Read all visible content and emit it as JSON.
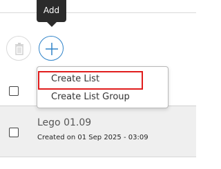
{
  "tooltip": {
    "text": "Add"
  },
  "toolbar": {
    "delete_icon": "trash-icon",
    "add_icon": "plus-icon",
    "accent_color": "#2f83c9"
  },
  "add_menu": {
    "items": [
      {
        "label": "Create List",
        "highlighted": true
      },
      {
        "label": "Create List Group",
        "highlighted": false
      }
    ],
    "highlight_color": "#e01b1b"
  },
  "list": {
    "rows": [
      {
        "title": "Lego 01.09",
        "meta": "Created on 01 Sep 2025 - 03:09",
        "checked": false
      }
    ]
  }
}
